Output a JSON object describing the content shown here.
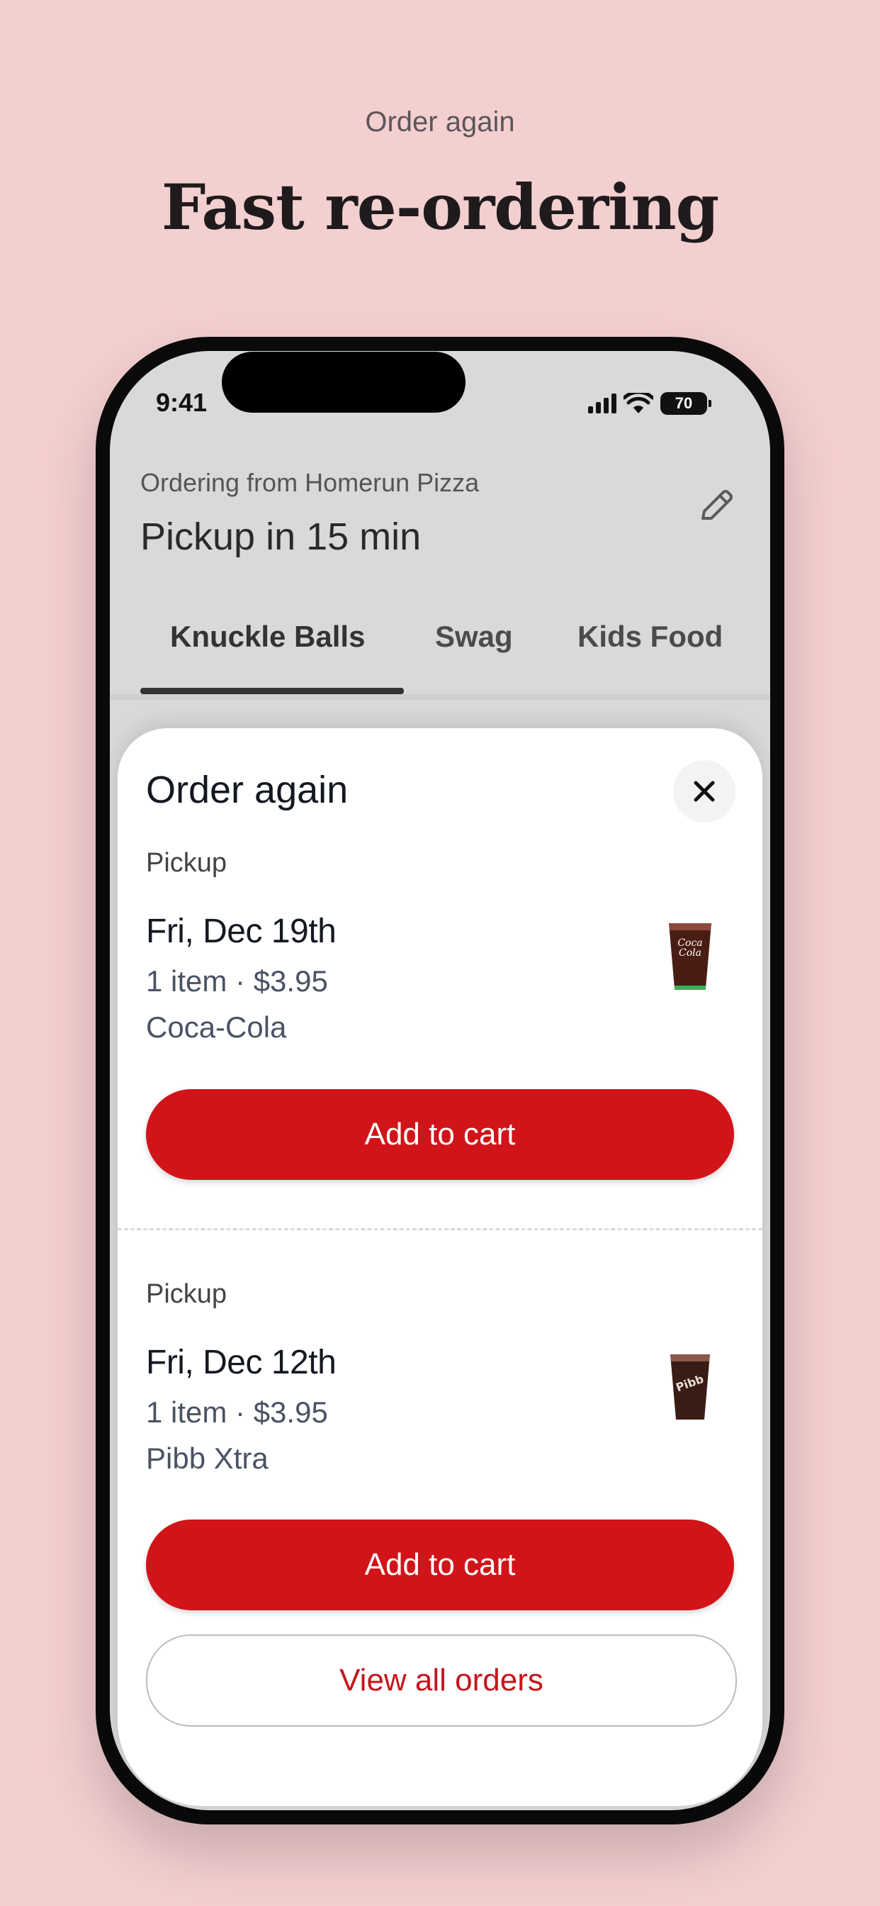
{
  "promo": {
    "eyebrow": "Order again",
    "headline": "Fast re-ordering"
  },
  "status_bar": {
    "time": "9:41",
    "battery": "70",
    "icons": [
      "cellular-signal-icon",
      "wifi-icon",
      "battery-icon"
    ]
  },
  "header": {
    "ordering_from": "Ordering from Homerun Pizza",
    "pickup_time": "Pickup in 15 min",
    "edit_icon": "pencil-icon"
  },
  "tabs": [
    {
      "label": "Knuckle Balls",
      "active": true
    },
    {
      "label": "Swag",
      "active": false
    },
    {
      "label": "Kids Food",
      "active": false
    }
  ],
  "sheet": {
    "title": "Order again",
    "close_icon": "close-icon",
    "orders": [
      {
        "type": "Pickup",
        "date": "Fri, Dec 19th",
        "meta": "1 item · $3.95",
        "item": "Coca-Cola",
        "image": "coca-cola-cup-icon",
        "button": "Add to cart"
      },
      {
        "type": "Pickup",
        "date": "Fri, Dec 12th",
        "meta": "1 item · $3.95",
        "item": "Pibb Xtra",
        "image": "pibb-xtra-cup-icon",
        "button": "Add to cart"
      }
    ],
    "view_all": "View all orders"
  },
  "colors": {
    "background": "#f4cfd0",
    "brand_red": "#d11419",
    "link_red": "#c4161c"
  }
}
